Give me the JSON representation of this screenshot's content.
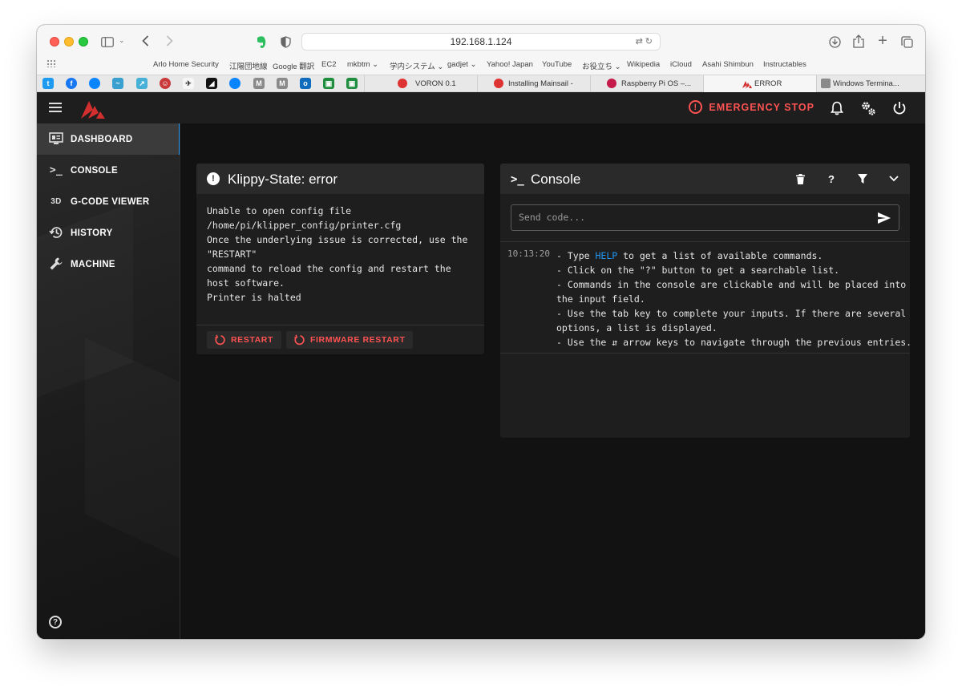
{
  "browser": {
    "url": "192.168.1.124",
    "favorites": [
      "Arlo Home Security",
      "江陽団地線",
      "Google 翻訳",
      "EC2",
      "mkbtm ⌄",
      "学内システム ⌄",
      "gadjet ⌄",
      "Yahoo! Japan",
      "YouTube",
      "お役立ち ⌄",
      "Wikipedia",
      "iCloud",
      "Asahi Shimbun",
      "Instructables"
    ],
    "tabs": [
      {
        "label": "VORON 0.1",
        "active": false
      },
      {
        "label": "Installing Mainsail -",
        "active": false
      },
      {
        "label": "Raspberry Pi OS –...",
        "active": false
      },
      {
        "label": "ERROR",
        "active": true
      },
      {
        "label": "Windows Termina...",
        "active": false
      }
    ],
    "pinned_icons": [
      "twitter-icon",
      "facebook-icon",
      "messenger-icon",
      "adobe-icon",
      "chart-icon",
      "octoprint-icon",
      "bird-icon",
      "autodesk-icon",
      "messenger-icon",
      "m-icon",
      "m-icon",
      "outlook-icon",
      "classroom-icon",
      "classroom-icon"
    ]
  },
  "appbar": {
    "emergency_stop": "EMERGENCY STOP"
  },
  "sidebar": {
    "items": [
      {
        "label": "DASHBOARD",
        "icon": "monitor-dashboard-icon",
        "active": true
      },
      {
        "label": "CONSOLE",
        "icon": "console-icon",
        "active": false
      },
      {
        "label": "G-CODE VIEWER",
        "icon": "3d-icon",
        "active": false
      },
      {
        "label": "HISTORY",
        "icon": "history-icon",
        "active": false
      },
      {
        "label": "MACHINE",
        "icon": "wrench-icon",
        "active": false
      }
    ],
    "icon_3d_text": "3D"
  },
  "klippy": {
    "title": "Klippy-State: error",
    "message_lines": [
      "Unable to open config file",
      "/home/pi/klipper_config/printer.cfg",
      "",
      "Once the underlying issue is corrected, use the",
      "\"RESTART\"",
      "command to reload the config and restart the",
      "host software.",
      "Printer is halted"
    ],
    "restart_label": "RESTART",
    "firmware_restart_label": "FIRMWARE RESTART"
  },
  "console": {
    "title": "Console",
    "input_placeholder": "Send code...",
    "input_value": "",
    "help_btn": "?",
    "entry": {
      "time": "10:13:20",
      "line1_prefix": "- Type ",
      "line1_cmd": "HELP",
      "line1_suffix": " to get a list of available commands.",
      "lines": [
        "- Click on the \"?\" button to get a searchable list.",
        "- Commands in the console are clickable and will be placed into",
        "the input field.",
        "- Use the tab key to complete your inputs. If there are several",
        "options, a list is displayed.",
        "- Use the ⇵ arrow keys to navigate through the previous entries."
      ]
    }
  },
  "colors": {
    "accent": "#2196f3",
    "error": "#ff5252",
    "app_bg": "#121212",
    "card_bg": "#1e1e1e"
  }
}
